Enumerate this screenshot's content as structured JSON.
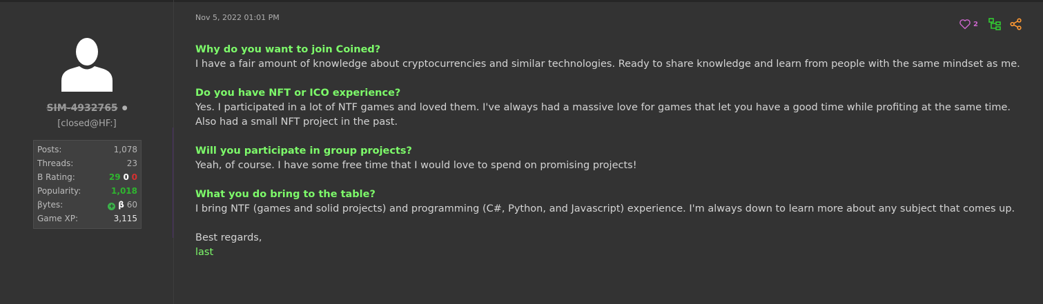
{
  "post": {
    "date": "Nov 5, 2022 01:01 PM",
    "like_count": "2",
    "sections": [
      {
        "question": "Why do you want to join Coined?",
        "answer": "I have a fair amount of knowledge about cryptocurrencies and similar technologies. Ready to share knowledge and learn from people with the same mindset as me."
      },
      {
        "question": "Do you have NFT or ICO experience?",
        "answer": "Yes. I participated in a lot of NTF games and loved them. I've always had a massive love for games that let you have a good time while profiting at the same time. Also had a small NFT project in the past."
      },
      {
        "question": "Will you participate in group projects?",
        "answer": "Yeah, of course. I have some free time that I would love to spend on promising projects!"
      },
      {
        "question": "What you do bring to the table?",
        "answer": "I bring NTF (games and solid projects) and programming (C#, Python, and Javascript) experience. I'm always down to learn more about any subject that comes up."
      }
    ],
    "closing": "Best regards,",
    "signature": "last"
  },
  "user": {
    "username": "SIM-4932765",
    "status_dot": "●",
    "title": "[closed@HF:]",
    "stats": {
      "posts_label": "Posts:",
      "posts": "1,078",
      "threads_label": "Threads:",
      "threads": "23",
      "brating_label": "B Rating:",
      "brating_pos": "29",
      "brating_neu": "0",
      "brating_neg": "0",
      "popularity_label": "Popularity:",
      "popularity": "1,018",
      "bytes_label": "βytes:",
      "bytes_symbol": "β",
      "bytes": "60",
      "gamexp_label": "Game XP:",
      "gamexp": "3,115"
    }
  },
  "icons": {
    "avatar": "default-avatar-icon",
    "like": "heart-icon",
    "tree": "thread-tree-icon",
    "share": "share-icon",
    "bytes": "plus-circle-icon"
  },
  "colors": {
    "background": "#333333",
    "question": "#7dfa6a",
    "like": "#cc66cc",
    "tree": "#33cc33",
    "share": "#ff9933",
    "rating_positive": "#2fb52f",
    "rating_negative": "#d83030"
  }
}
